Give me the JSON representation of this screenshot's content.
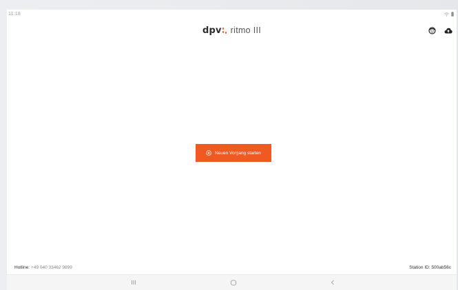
{
  "status_bar": {
    "time": "11:18",
    "icons": [
      "wifi-icon",
      "battery-icon"
    ]
  },
  "header": {
    "brand_logo": "dpv",
    "brand_app": "ritmo III",
    "brand_accent_color": "#ee5a24",
    "actions": [
      {
        "name": "profile-face-icon"
      },
      {
        "name": "cloud-upload-icon"
      }
    ]
  },
  "main": {
    "start_button": {
      "label": "Neuen Vorgang starten",
      "icon": "plus-circle-icon",
      "color": "#f05a22"
    }
  },
  "footer": {
    "hotline_label": "Hotline:",
    "hotline_number": "+49 040 33462 9899",
    "station_id": "Station ID: 500ab56c"
  },
  "nav_bar": {
    "buttons": [
      "recent-apps-icon",
      "home-icon",
      "back-icon"
    ]
  }
}
